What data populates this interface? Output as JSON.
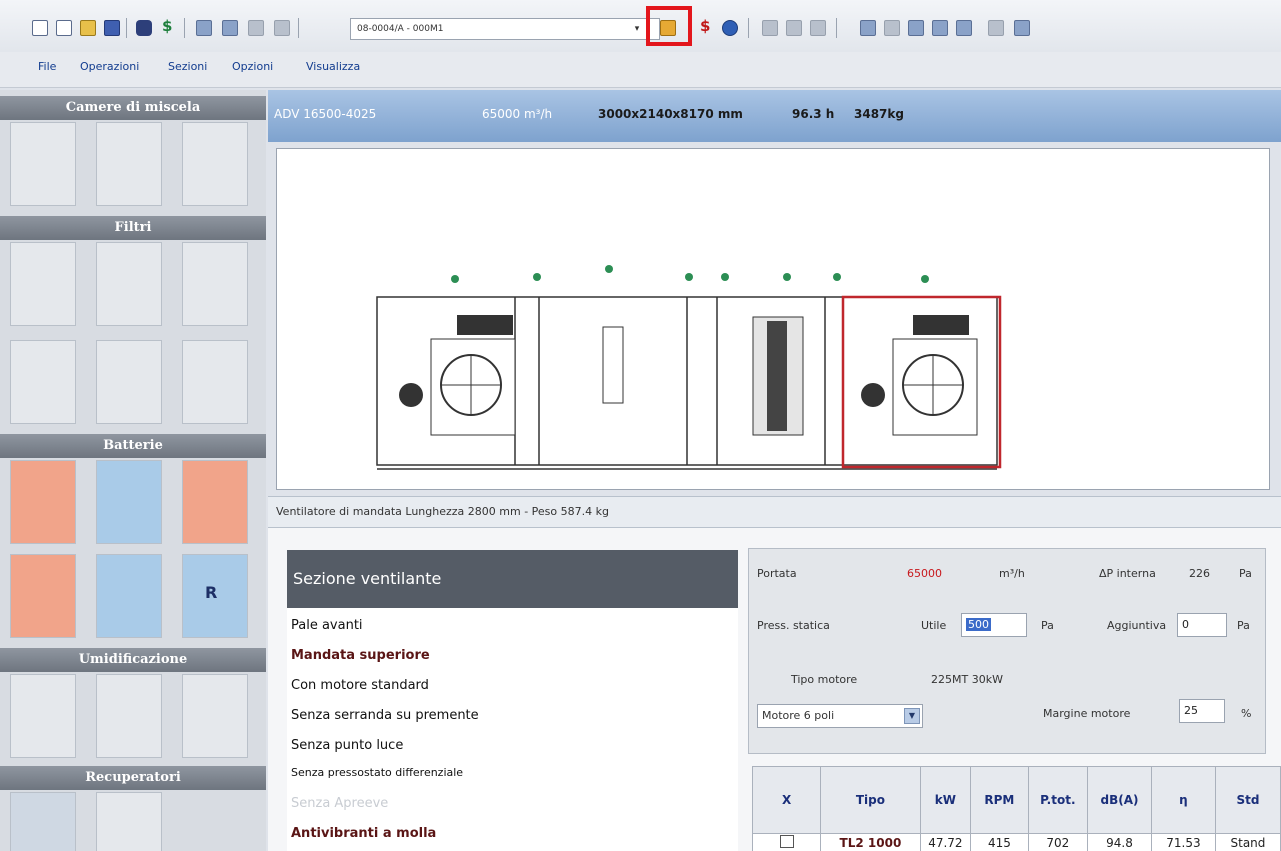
{
  "toolbar": {
    "file_combo_value": "08-0004/A - 000M1",
    "combo_arrow": "▾",
    "icons": [
      "new-document-icon",
      "document-icon",
      "open-folder-icon",
      "save-icon",
      "binoculars-icon",
      "dollar-icon",
      "tool-icon",
      "tool2-icon",
      "tool3-icon",
      "tool4-icon",
      "settings-icon",
      "price-dollar-icon",
      "help-icon",
      "save2-icon",
      "undo-icon",
      "redo-icon",
      "copy-icon",
      "wrench-icon",
      "save3-icon",
      "zoom-in-icon",
      "zoom-out-icon",
      "cursor-icon",
      "stop-icon"
    ],
    "highlight_color": "#e3161c"
  },
  "menu": {
    "items": [
      "File",
      "Operazioni",
      "Sezioni",
      "Opzioni",
      "Visualizza"
    ]
  },
  "sidebar": {
    "headers": [
      "Camere di miscela",
      "Filtri",
      "Batterie",
      "Umidificazione",
      "Recuperatori"
    ],
    "battery_letter": "R"
  },
  "title_strip": {
    "model": "ADV 16500-4025",
    "airflow": "65000 m³/h",
    "dimensions": "3000x2140x8170 mm",
    "height": "96.3 h",
    "weight": "3487kg"
  },
  "detail_strip": {
    "text": "Ventilatore di mandata  Lunghezza 2800 mm - Peso 587.4 kg"
  },
  "section": {
    "title": "Sezione ventilante",
    "options": [
      {
        "label": "Pale avanti",
        "style": "normal"
      },
      {
        "label": "Mandata superiore",
        "style": "bold"
      },
      {
        "label": "Con motore standard",
        "style": "normal"
      },
      {
        "label": "Senza serranda su premente",
        "style": "normal"
      },
      {
        "label": "Senza punto luce",
        "style": "normal"
      },
      {
        "label": "Senza pressostato differenziale",
        "style": "normal"
      },
      {
        "label": "Senza Apreeve",
        "style": "faded"
      },
      {
        "label": "Antivibranti a molla",
        "style": "bold"
      }
    ]
  },
  "params": {
    "portata_label": "Portata",
    "portata_value": "65000",
    "portata_unit": "m³/h",
    "dp_interna_label": "ΔP interna",
    "dp_interna_value": "226",
    "dp_interna_unit": "Pa",
    "press_statica_label": "Press. statica",
    "utile_label": "Utile",
    "utile_value": "500",
    "utile_unit": "Pa",
    "aggiuntiva_label": "Aggiuntiva",
    "aggiuntiva_value": "0",
    "aggiuntiva_unit": "Pa",
    "tipo_motore_label": "Tipo motore",
    "tipo_motore_value": "225MT 30kW",
    "motore_select": "Motore 6 poli",
    "margine_label": "Margine motore",
    "margine_value": "25",
    "margine_unit": "%"
  },
  "fan_table": {
    "headers": [
      "X",
      "Tipo",
      "kW",
      "RPM",
      "P.tot.",
      "dB(A)",
      "η",
      "Std"
    ],
    "row": {
      "tipo": "TL2 1000",
      "kw": "47.72",
      "rpm": "415",
      "ptot": "702",
      "db": "94.8",
      "eta": "71.53",
      "std": "Stand"
    }
  }
}
